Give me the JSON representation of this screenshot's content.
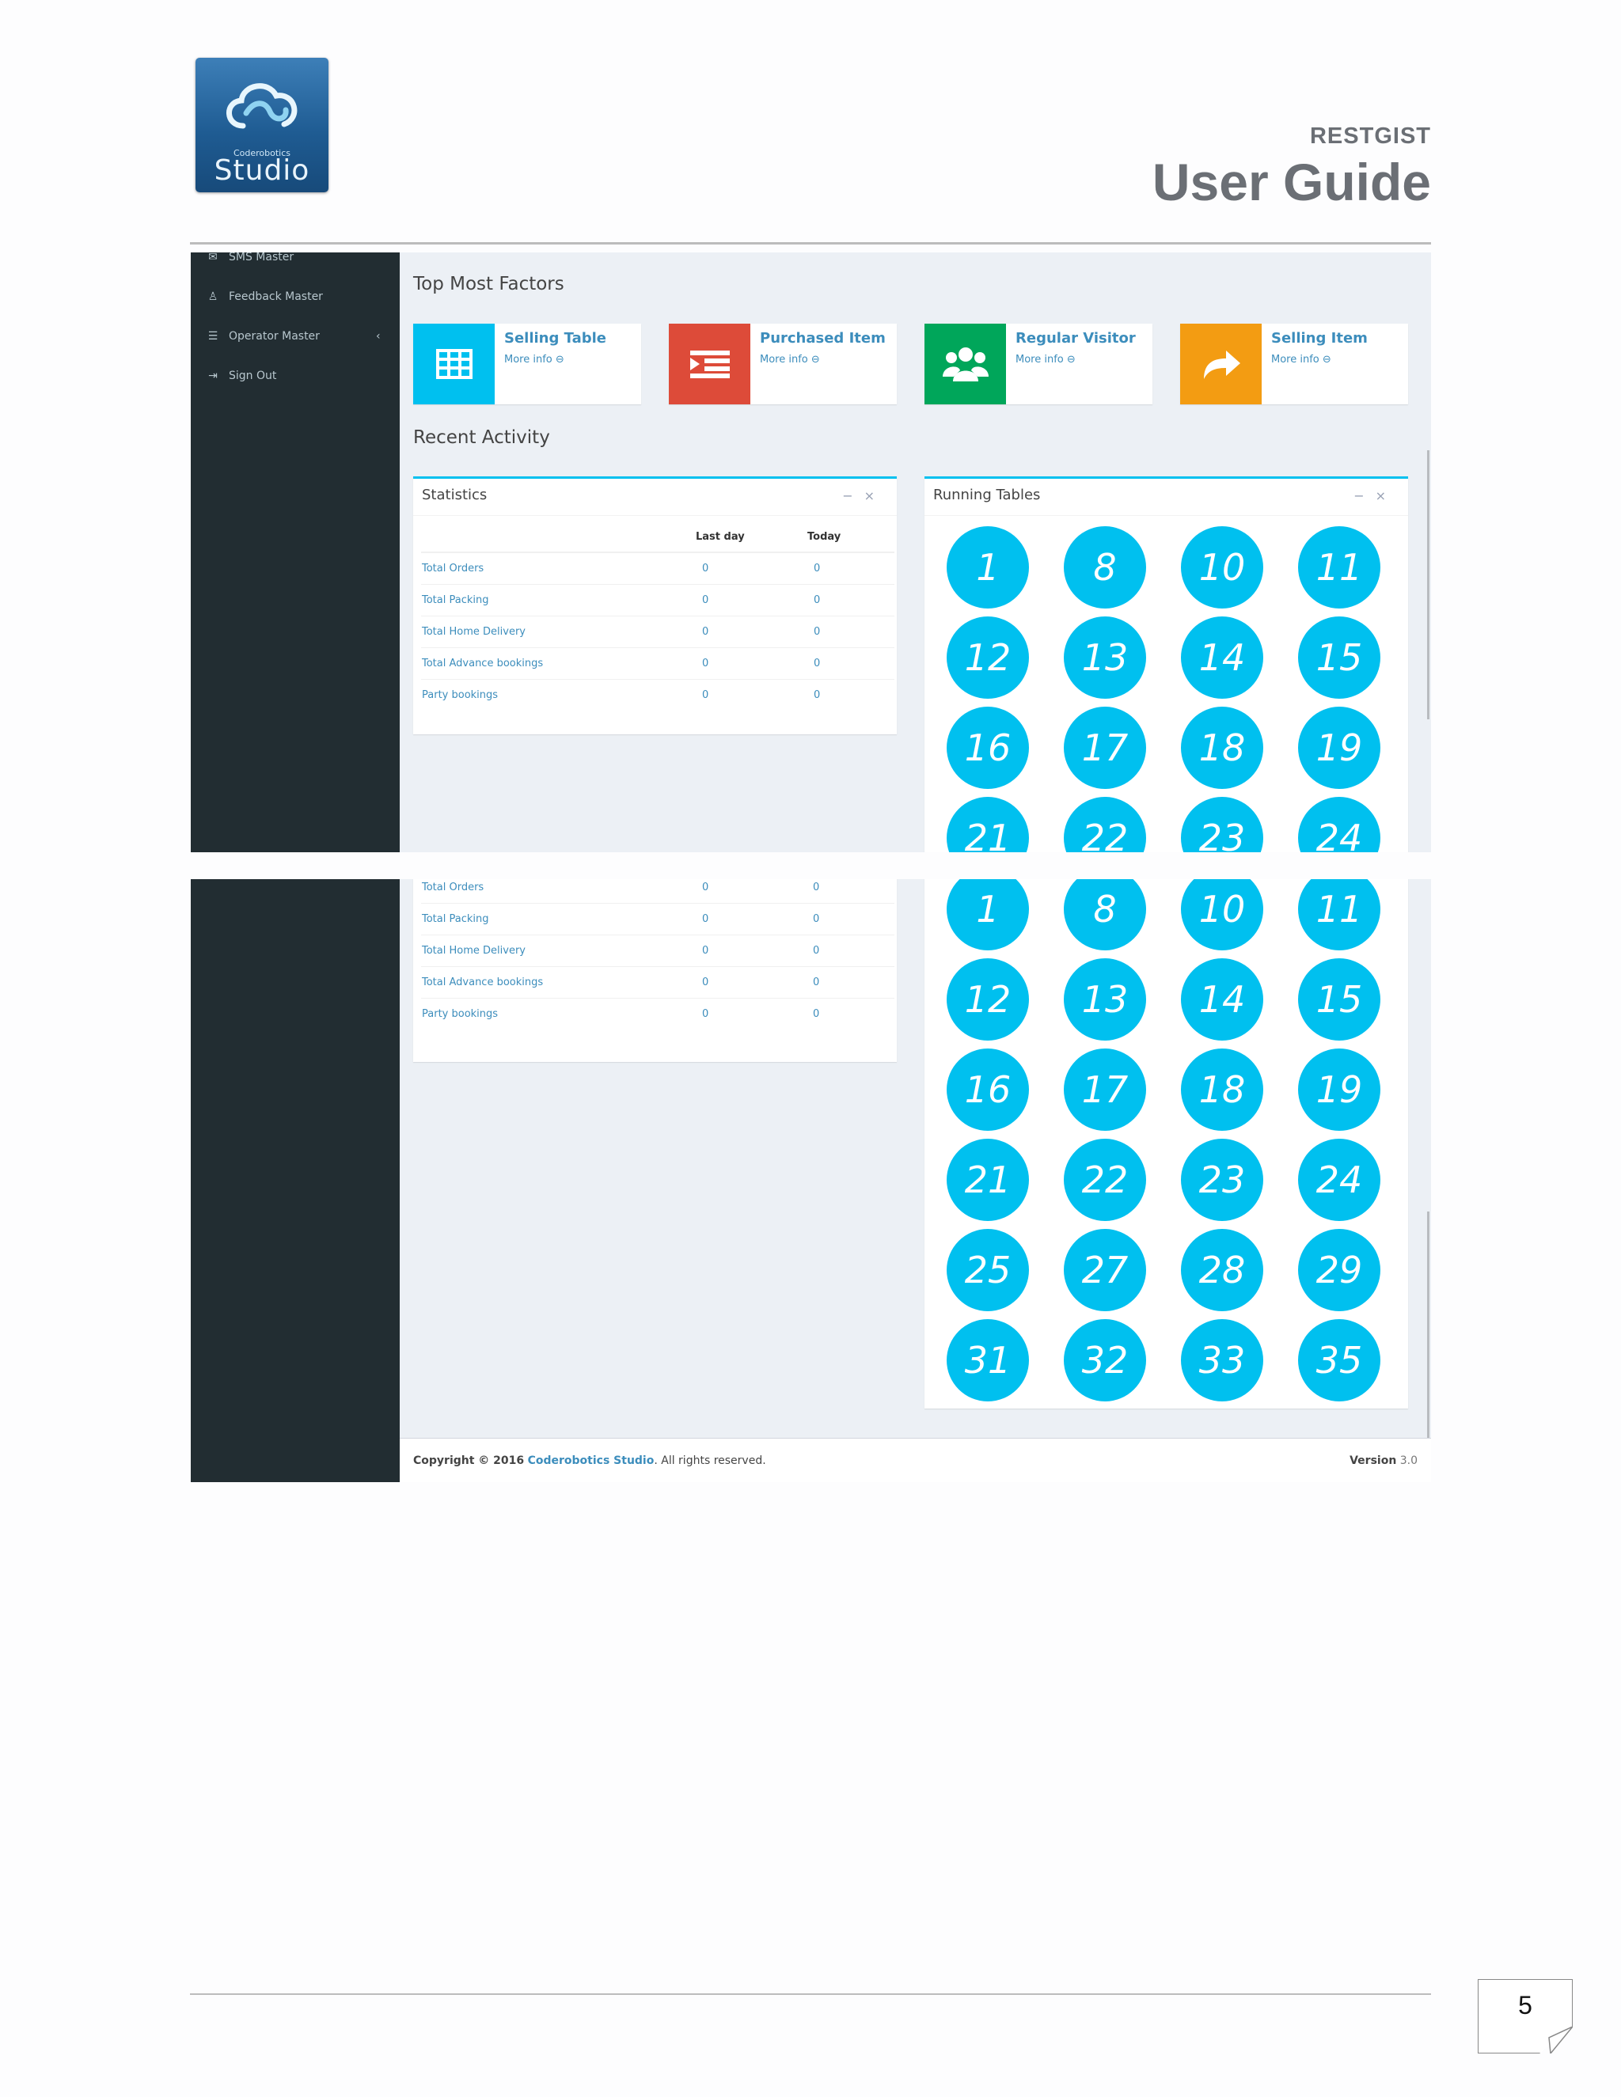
{
  "header": {
    "logo": {
      "small_text": "Coderobotics",
      "big_text": "Studio"
    },
    "brand": "RESTGIST",
    "title": "User Guide"
  },
  "page_number": "5",
  "sidebar": {
    "items": [
      {
        "label": "SMS Master",
        "icon": "envelope-icon"
      },
      {
        "label": "Feedback Master",
        "icon": "user-icon"
      },
      {
        "label": "Operator Master",
        "icon": "list-icon",
        "caret": "‹"
      },
      {
        "label": "Sign Out",
        "icon": "sign-out-icon"
      }
    ]
  },
  "dashboard": {
    "top_title": "Top Most Factors",
    "info_boxes": [
      {
        "title": "Selling Table",
        "more": "More info",
        "color": "#00c0ef",
        "icon": "table-icon"
      },
      {
        "title": "Purchased Item",
        "more": "More info",
        "color": "#dd4b39",
        "icon": "indent-icon"
      },
      {
        "title": "Regular Visitor",
        "more": "More info",
        "color": "#00a65a",
        "icon": "users-icon"
      },
      {
        "title": "Selling Item",
        "more": "More info",
        "color": "#f39c12",
        "icon": "share-icon"
      }
    ],
    "recent_title": "Recent Activity",
    "statistics": {
      "title": "Statistics",
      "col_last": "Last day",
      "col_today": "Today",
      "rows": [
        {
          "label": "Total Orders",
          "last": "0",
          "today": "0"
        },
        {
          "label": "Total Packing",
          "last": "0",
          "today": "0"
        },
        {
          "label": "Total Home Delivery",
          "last": "0",
          "today": "0"
        },
        {
          "label": "Total Advance bookings",
          "last": "0",
          "today": "0"
        },
        {
          "label": "Party bookings",
          "last": "0",
          "today": "0"
        }
      ]
    },
    "running_tables": {
      "title": "Running Tables",
      "tables": [
        "1",
        "8",
        "10",
        "11",
        "12",
        "13",
        "14",
        "15",
        "16",
        "17",
        "18",
        "19",
        "21",
        "22",
        "23",
        "24",
        "25",
        "27",
        "28",
        "29",
        "31",
        "32",
        "33",
        "35"
      ]
    },
    "footer": {
      "copyright_prefix": "Copyright © 2016",
      "company": "Coderobotics Studio",
      "rights": ". All rights reserved.",
      "version_label": "Version",
      "version": "3.0"
    }
  }
}
